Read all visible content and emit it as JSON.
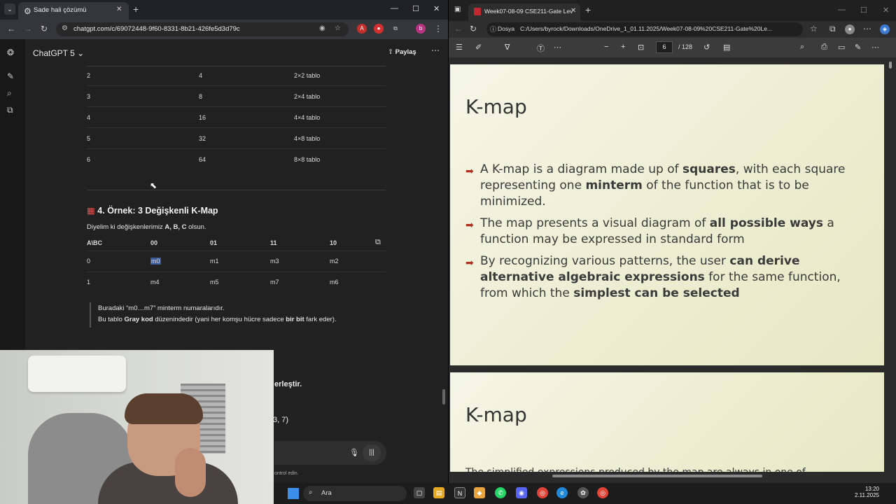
{
  "left_browser": {
    "tab_title": "Sade hali çözümü",
    "url": "chatgpt.com/c/69072448-9f60-8331-8b21-426fe5d3d79c",
    "chat_name": "ChatGPT 5",
    "share_label": "Paylaş",
    "size_table": [
      {
        "vars": "2",
        "cells": "4",
        "shape": "2×2 tablo"
      },
      {
        "vars": "3",
        "cells": "8",
        "shape": "2×4 tablo"
      },
      {
        "vars": "4",
        "cells": "16",
        "shape": "4×4 tablo"
      },
      {
        "vars": "5",
        "cells": "32",
        "shape": "4×8 tablo"
      },
      {
        "vars": "6",
        "cells": "64",
        "shape": "8×8 tablo"
      }
    ],
    "section_heading": "4. Örnek: 3 Değişkenli K-Map",
    "intro_prefix": "Diyelim ki değişkenlerimiz ",
    "intro_vars": "A, B, C",
    "intro_suffix": " olsun.",
    "kmap": {
      "headers": [
        "A\\BC",
        "00",
        "01",
        "11",
        "10"
      ],
      "rows": [
        [
          "0",
          "m0",
          "m1",
          "m3",
          "m2"
        ],
        [
          "1",
          "m4",
          "m5",
          "m7",
          "m6"
        ]
      ]
    },
    "note_line1": "Buradaki “m0…m7” minterm numaralarıdır.",
    "note2_a": "Bu tablo ",
    "note2_b": "Gray kod",
    "note2_c": " düzenindedir (yani her komşu hücre sadece ",
    "note2_d": "bir bit",
    "note2_e": " fark eder).",
    "partial_text_1": "erleştir.",
    "partial_text_2": "3, 7)",
    "footer_partial": "ontrol edin."
  },
  "right_pdf": {
    "tab_title": "Week07-08-09 CSE211-Gate Lev",
    "file_label": "Dosya",
    "path": "C:/Users/byrock/Downloads/OneDrive_1_01.11.2025/Week07-08-09%20CSE211-Gate%20Le...",
    "page_current": "6",
    "page_total": "/ 128",
    "slide1": {
      "title": "K-map",
      "bullets": [
        [
          "A K-map is a diagram made up of ",
          "squares",
          ", with each square representing one ",
          "minterm",
          " of the function that is to be minimized."
        ],
        [
          "The map presents a visual diagram of ",
          "all possible ways",
          " a function may be expressed in standard form",
          "",
          ""
        ],
        [
          "By recognizing various patterns, the user ",
          "can derive alternative algebraic expressions",
          " for the same function, from which the ",
          "simplest can be selected",
          ""
        ]
      ]
    },
    "slide2": {
      "title": "K-map",
      "partial": "The simplified expressions produced by the map are always in one of"
    }
  },
  "taskbar": {
    "search_label": "Ara",
    "time": "13:20",
    "date": "2.11.2025"
  },
  "colors": {
    "bullet_arrow": "#b0301f",
    "chat_bg": "#212121",
    "selection": "#3b5a9a"
  }
}
